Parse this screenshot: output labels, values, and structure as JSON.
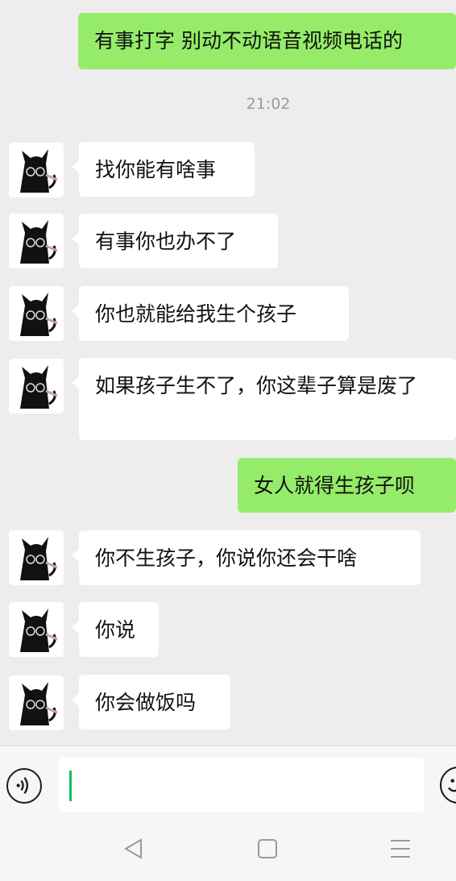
{
  "messages": [
    {
      "side": "out",
      "text": "有事打字 别动不动语音视频电话的"
    },
    {
      "side": "in",
      "text": "找你能有啥事"
    },
    {
      "side": "in",
      "text": "有事你也办不了"
    },
    {
      "side": "in",
      "text": "你也就能给我生个孩子"
    },
    {
      "side": "in",
      "text": "如果孩子生不了，你这辈子算是废了"
    },
    {
      "side": "out",
      "text": "女人就得生孩子呗"
    },
    {
      "side": "in",
      "text": "你不生孩子，你说你还会干啥"
    },
    {
      "side": "in",
      "text": "你说"
    },
    {
      "side": "in",
      "text": "你会做饭吗"
    }
  ],
  "timestamp": "21:02",
  "icons": {
    "voice": "voice-wave-icon",
    "emoji": "smiley-face-icon",
    "back": "triangle-back-icon",
    "home": "square-home-icon",
    "menu": "three-lines-menu-icon"
  },
  "colors": {
    "background": "#ededed",
    "outgoing_bubble": "#95ec69",
    "incoming_bubble": "#ffffff",
    "cursor": "#07c160"
  }
}
